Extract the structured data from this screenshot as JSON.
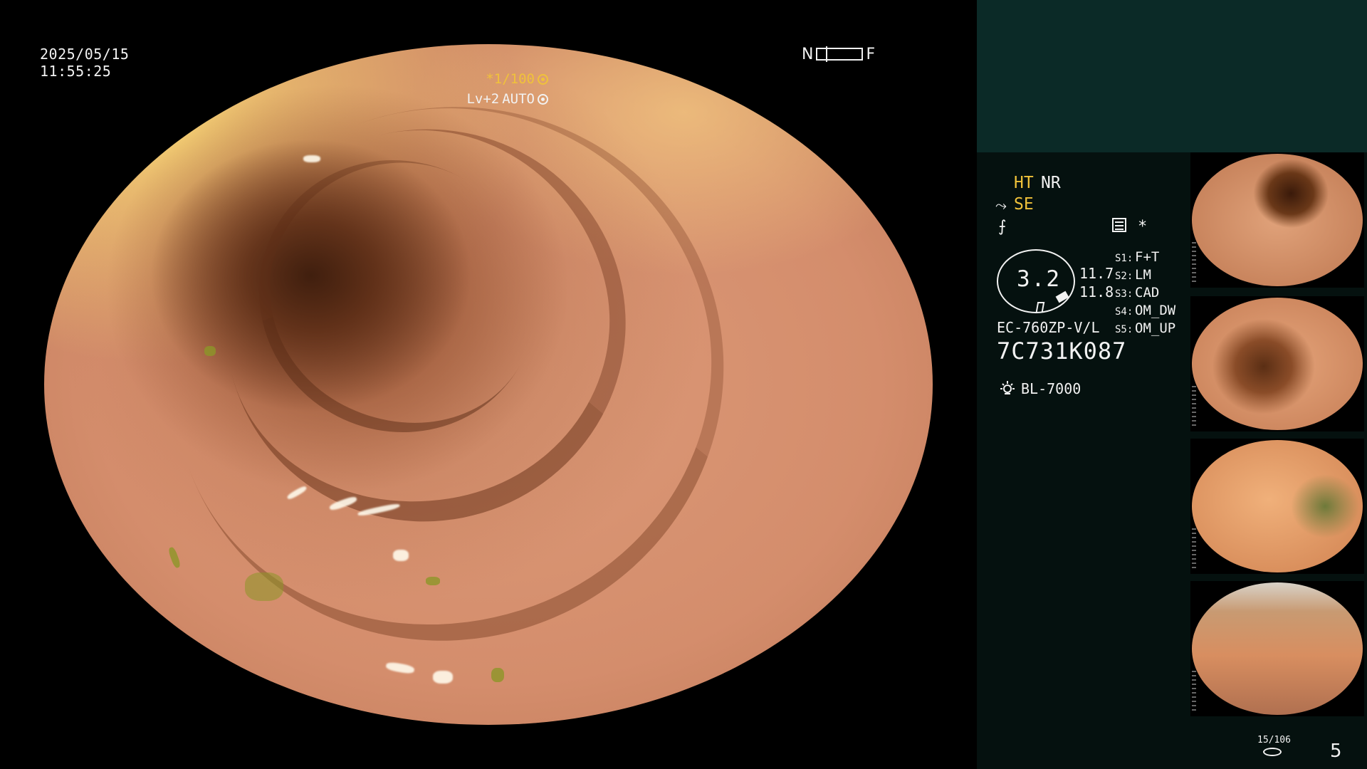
{
  "main_view": {
    "date": "2025/05/15",
    "time": "11:55:25",
    "near_label": "N",
    "far_label": "F",
    "shutter": "*1/100",
    "shutter_icon": "aperture-icon",
    "level": "Lv+2",
    "mode": "AUTO",
    "mode_icon": "iris-icon"
  },
  "info_panel": {
    "ht_label": "HT",
    "nr_label": "NR",
    "se_label": "SE",
    "asterisk": "*",
    "gauge_value": "3.2",
    "value_1": "11.7",
    "value_2": "11.8",
    "switches": [
      {
        "key": "S1:",
        "value": "F+T"
      },
      {
        "key": "S2:",
        "value": "LM"
      },
      {
        "key": "S3:",
        "value": "CAD"
      },
      {
        "key": "S4:",
        "value": "OM_DW"
      },
      {
        "key": "S5:",
        "value": "OM_UP"
      }
    ],
    "scope_model": "EC-760ZP-V/L",
    "scope_serial": "7C731K087",
    "light_source": "BL-7000",
    "page_count": "15/106",
    "capture_number": "5",
    "colors": {
      "accent_yellow": "#f0c23a",
      "panel_top": "#0b2a27",
      "panel_bg": "#05110f"
    }
  }
}
